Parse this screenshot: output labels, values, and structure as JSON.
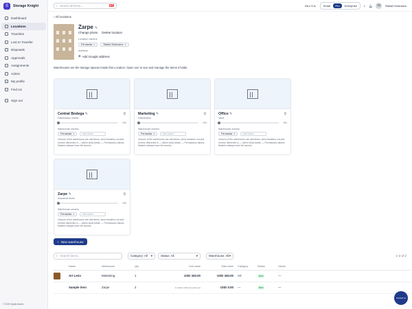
{
  "app": {
    "name": "Storage Knight",
    "copyright": "© 2026 Digital Assets"
  },
  "sidebar": {
    "items": [
      {
        "label": "Dashboard",
        "icon": "dashboard-icon"
      },
      {
        "label": "Locations",
        "icon": "location-icon",
        "active": true
      },
      {
        "label": "Transfers",
        "icon": "transfer-icon"
      },
      {
        "label": "Lost to Transfer",
        "icon": "lost-icon"
      },
      {
        "label": "Disposals",
        "icon": "disposal-icon"
      },
      {
        "label": "Approvals",
        "icon": "approval-icon"
      },
      {
        "label": "Assignments",
        "icon": "assignment-icon"
      },
      {
        "label": "Admin",
        "icon": "admin-icon"
      },
      {
        "label": "My profile",
        "icon": "profile-icon"
      },
      {
        "label": "Find Us",
        "icon": "map-icon"
      },
      {
        "label": "Sign out",
        "icon": "signout-icon"
      }
    ]
  },
  "topbar": {
    "search_placeholder": "Search all items...",
    "kbd": "⌘K",
    "org": "Zeru S.A.",
    "plans": [
      "Smart",
      "Pro",
      "Enterprise"
    ],
    "active_plan": "Pro",
    "initials": "RS",
    "user": "Rafael Solorzano"
  },
  "location": {
    "breadcrumb": "All locations",
    "name": "Zarpe",
    "change_photo": "Change photo",
    "delete": "Delete location",
    "owners_label": "Location owners",
    "owners": [
      "Fernanda",
      "Rafael Solorzano"
    ],
    "address_label": "Address",
    "add_address": "Add Google address",
    "description": "Warehouses are the storage spaces inside this Location. Open one to see and manage the items it holds."
  },
  "warehouses": [
    {
      "name": "Central Bodega",
      "type": "Distribution center",
      "pct": "0%"
    },
    {
      "name": "Marketing",
      "type": "Distribution",
      "pct": "0%"
    },
    {
      "name": "Office",
      "type": "Vault",
      "pct": "0%"
    },
    {
      "name": "Zarpe",
      "type": "Industrial shed",
      "pct": "0%"
    }
  ],
  "card_common": {
    "owners_label": "Warehouse owners",
    "owner": "Fernanda",
    "add_owner": "Add owner...",
    "note": "Owners of the warehouse can add items, send transfers out and receive deliveries in — within what Admin — Permissions allows. Masters always have full access."
  },
  "new_warehouse": "New warehouse",
  "filters": {
    "search_placeholder": "Search items...",
    "category": "Category: All",
    "status": "Status: All",
    "warehouse": "Warehouse: All",
    "count": "1–2 of 2"
  },
  "table": {
    "headers": [
      "Name",
      "Warehouse",
      "Qty",
      "Unit value",
      "Total value",
      "Category",
      "Status",
      "Owner"
    ],
    "rows": [
      {
        "name": "Art León",
        "warehouse": "Marketing",
        "qty": "1",
        "unit": "USD 340.00",
        "total": "USD 340.00",
        "category": "Art",
        "status": "New",
        "owner": "—",
        "note": ""
      },
      {
        "name": "Sample item",
        "warehouse": "Zarpe",
        "qty": "2",
        "unit": "",
        "total": "USD 0.00",
        "category": "—",
        "status": "New",
        "owner": "—",
        "note": "2 units(s) without a price set"
      }
    ]
  },
  "help": "Contact us"
}
